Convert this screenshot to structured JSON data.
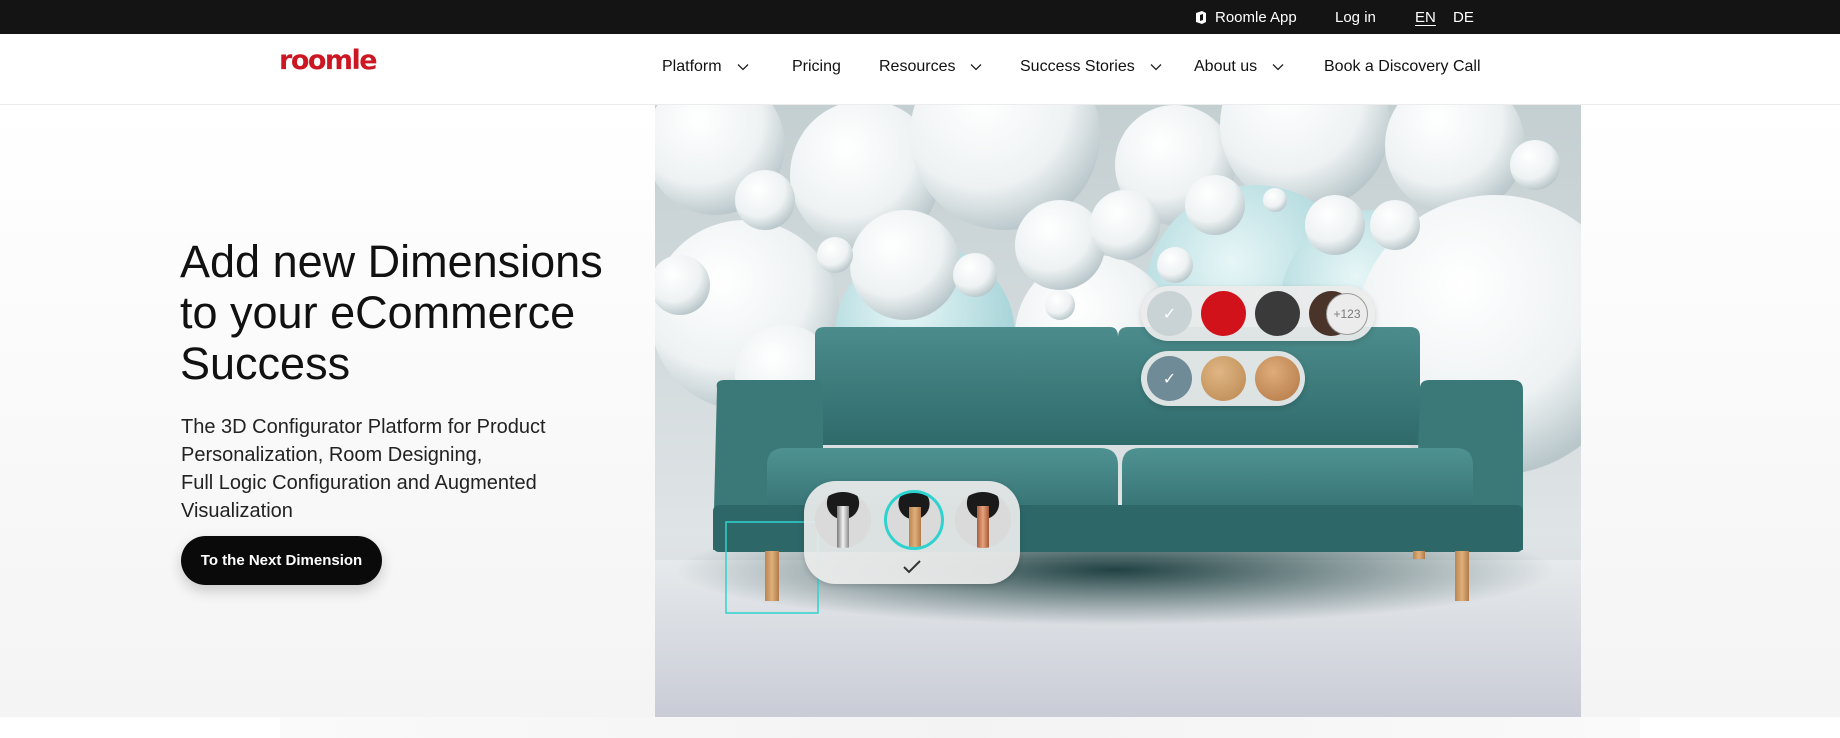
{
  "topbar": {
    "app_label": "Roomle App",
    "login_label": "Log in",
    "lang_en": "EN",
    "lang_de": "DE"
  },
  "nav": {
    "logo": "roomle",
    "items": [
      {
        "label": "Platform",
        "has_dropdown": true
      },
      {
        "label": "Pricing",
        "has_dropdown": false
      },
      {
        "label": "Resources",
        "has_dropdown": true
      },
      {
        "label": "Success Stories",
        "has_dropdown": true
      },
      {
        "label": "About us",
        "has_dropdown": true
      },
      {
        "label": "Book a Discovery Call",
        "has_dropdown": false
      }
    ]
  },
  "hero": {
    "headline": "Add new Dimensions to your eCommerce Success",
    "sub_line_1": "The 3D Configurator Platform for Product",
    "sub_line_2": "Personalization, Room Designing,",
    "sub_line_3": "Full Logic Configuration and Augmented Visualization",
    "cta_label": "To the Next Dimension"
  },
  "configurator": {
    "fabric_colors": [
      "#c9d2d4",
      "#d2121a",
      "#3a3a3a",
      "#4a342a"
    ],
    "more_label": "+123",
    "leg_materials": [
      "#6f8b98",
      "#c99c6a",
      "#c08a5a"
    ],
    "leg_styles": [
      "chrome",
      "wood",
      "copper"
    ]
  },
  "colors": {
    "brand_red": "#cc1622",
    "sofa_teal": "#3e7e7e",
    "accent_cyan": "#2ed3cf"
  }
}
